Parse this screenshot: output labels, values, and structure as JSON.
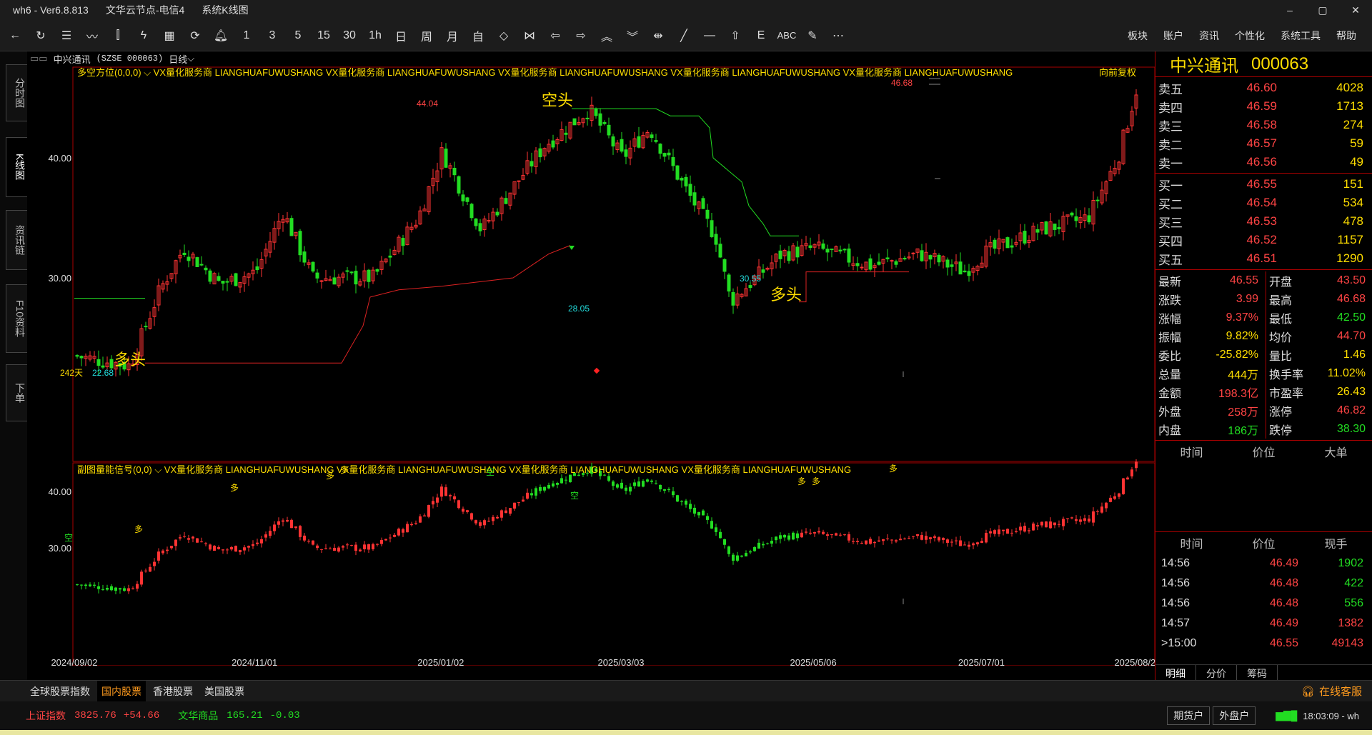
{
  "window": {
    "app": "wh6 - Ver6.8.813",
    "node": "文华云节点-电信4",
    "view": "系统K线图",
    "controls": [
      "–",
      "▢",
      "✕"
    ]
  },
  "toolbar": {
    "periods": [
      "1",
      "3",
      "5",
      "15",
      "30",
      "1h",
      "日",
      "周",
      "月",
      "自"
    ],
    "menu": [
      "板块",
      "账户",
      "资讯",
      "个性化",
      "系统工具",
      "帮助"
    ]
  },
  "left_tabs": [
    "分时图",
    "K线图",
    "资讯链",
    "F10资料",
    "下单"
  ],
  "chart_header": {
    "name": "中兴通讯",
    "code": "(SZSE 000063)",
    "period": "日线"
  },
  "main_panel": {
    "indicator": "多空方位(0,0,0)",
    "ads": [
      "VX量化服务商",
      "LIANGHUAFUWUSHANG",
      "VX量化服务商",
      "LIANGHUAFUWUSHANG",
      "VX量化服务商",
      "LIANGHUAFUWUSHANG",
      "VX量化服务商",
      "LIANGHUAFUWUSHANG",
      "VX量化服务商",
      "LIANGHUAFUWUSHANG"
    ],
    "adjust": "向前复权",
    "y_ticks": [
      "40.00",
      "30.00"
    ],
    "labels": {
      "high": "44.04",
      "last_high": "46.68",
      "low1": "22.68",
      "low2": "28.05",
      "low3": "30.55",
      "days": "242天",
      "bear": "空头",
      "bull1": "多头",
      "bull2": "多头"
    }
  },
  "sub_panel": {
    "indicator": "副图量能信号(0,0)",
    "ads": [
      "VX量化服务商",
      "LIANGHUAFUWUSHANG",
      "VX量化服务商",
      "LIANGHUAFUWUSHANG",
      "VX量化服务商",
      "LIANGHUAFUWUSHANG",
      "VX量化服务商",
      "LIANGHUAFUWUSHANG"
    ],
    "y_ticks": [
      "40.00",
      "30.00"
    ],
    "signals": [
      "空",
      "多",
      "多",
      "多",
      "多",
      "空",
      "空",
      "多",
      "多",
      "多"
    ]
  },
  "x_axis": [
    "2024/09/02",
    "2024/11/01",
    "2025/01/02",
    "2025/03/03",
    "2025/05/06",
    "2025/07/01",
    "2025/08/22"
  ],
  "chart_data": {
    "type": "candlestick",
    "x_range": [
      "2024/09/02",
      "2025/08/22"
    ],
    "ylim": [
      20,
      48
    ],
    "points": [
      {
        "date": "2024/09/02",
        "close": 23.5
      },
      {
        "date": "2024/09/20",
        "close": 22.68
      },
      {
        "date": "2024/09/30",
        "close": 29.0
      },
      {
        "date": "2024/10/08",
        "close": 32.5
      },
      {
        "date": "2024/10/20",
        "close": 29.5
      },
      {
        "date": "2024/11/01",
        "close": 30.5
      },
      {
        "date": "2024/11/10",
        "close": 35.5
      },
      {
        "date": "2024/11/20",
        "close": 30.0
      },
      {
        "date": "2024/12/10",
        "close": 30.0
      },
      {
        "date": "2024/12/25",
        "close": 35.0
      },
      {
        "date": "2025/01/02",
        "close": 40.5
      },
      {
        "date": "2025/01/15",
        "close": 34.0
      },
      {
        "date": "2025/02/05",
        "close": 41.0
      },
      {
        "date": "2025/02/20",
        "close": 44.04
      },
      {
        "date": "2025/03/03",
        "close": 40.0
      },
      {
        "date": "2025/03/12",
        "close": 42.5
      },
      {
        "date": "2025/03/25",
        "close": 37.0
      },
      {
        "date": "2025/04/03",
        "close": 33.5
      },
      {
        "date": "2025/04/08",
        "close": 28.05
      },
      {
        "date": "2025/04/25",
        "close": 32.0
      },
      {
        "date": "2025/05/06",
        "close": 32.5
      },
      {
        "date": "2025/05/25",
        "close": 31.0
      },
      {
        "date": "2025/06/10",
        "close": 32.0
      },
      {
        "date": "2025/06/25",
        "close": 30.55
      },
      {
        "date": "2025/07/01",
        "close": 32.0
      },
      {
        "date": "2025/07/20",
        "close": 34.0
      },
      {
        "date": "2025/08/05",
        "close": 35.0
      },
      {
        "date": "2025/08/15",
        "close": 40.0
      },
      {
        "date": "2025/08/22",
        "close": 46.55
      }
    ],
    "bear_line": 44.0,
    "bull_line": 33.5
  },
  "quote": {
    "name": "中兴通讯",
    "code": "000063",
    "asks": [
      {
        "label": "卖五",
        "price": "46.60",
        "vol": "4028"
      },
      {
        "label": "卖四",
        "price": "46.59",
        "vol": "1713"
      },
      {
        "label": "卖三",
        "price": "46.58",
        "vol": "274"
      },
      {
        "label": "卖二",
        "price": "46.57",
        "vol": "59"
      },
      {
        "label": "卖一",
        "price": "46.56",
        "vol": "49"
      }
    ],
    "bids": [
      {
        "label": "买一",
        "price": "46.55",
        "vol": "151"
      },
      {
        "label": "买二",
        "price": "46.54",
        "vol": "534"
      },
      {
        "label": "买三",
        "price": "46.53",
        "vol": "478"
      },
      {
        "label": "买四",
        "price": "46.52",
        "vol": "1157"
      },
      {
        "label": "买五",
        "price": "46.51",
        "vol": "1290"
      }
    ],
    "stats": [
      {
        "k": "最新",
        "v": "46.55",
        "c": "#ff4444"
      },
      {
        "k": "开盘",
        "v": "43.50",
        "c": "#ff4444"
      },
      {
        "k": "涨跌",
        "v": "3.99",
        "c": "#ff4444"
      },
      {
        "k": "最高",
        "v": "46.68",
        "c": "#ff4444"
      },
      {
        "k": "涨幅",
        "v": "9.37%",
        "c": "#ff4444"
      },
      {
        "k": "最低",
        "v": "42.50",
        "c": "#22dd22"
      },
      {
        "k": "振幅",
        "v": "9.82%",
        "c": "#ffde00"
      },
      {
        "k": "均价",
        "v": "44.70",
        "c": "#ff4444"
      },
      {
        "k": "委比",
        "v": "-25.82%",
        "c": "#ffde00"
      },
      {
        "k": "量比",
        "v": "1.46",
        "c": "#ffde00"
      },
      {
        "k": "总量",
        "v": "444万",
        "c": "#ffde00"
      },
      {
        "k": "换手率",
        "v": "11.02%",
        "c": "#ffde00"
      },
      {
        "k": "金额",
        "v": "198.3亿",
        "c": "#ff4444"
      },
      {
        "k": "市盈率",
        "v": "26.43",
        "c": "#ffde00"
      },
      {
        "k": "外盘",
        "v": "258万",
        "c": "#ff4444"
      },
      {
        "k": "涨停",
        "v": "46.82",
        "c": "#ff4444"
      },
      {
        "k": "内盘",
        "v": "186万",
        "c": "#22dd22"
      },
      {
        "k": "跌停",
        "v": "38.30",
        "c": "#22dd22"
      }
    ],
    "big_header": [
      "时间",
      "价位",
      "大单"
    ],
    "tick_header": [
      "时间",
      "价位",
      "现手"
    ],
    "ticks": [
      {
        "t": "14:56",
        "p": "46.49",
        "v": "1902",
        "c": "#22dd22"
      },
      {
        "t": "14:56",
        "p": "46.48",
        "v": "422",
        "c": "#22dd22"
      },
      {
        "t": "14:56",
        "p": "46.48",
        "v": "556",
        "c": "#22dd22"
      },
      {
        "t": "14:57",
        "p": "46.49",
        "v": "1382",
        "c": "#ff4444"
      },
      {
        "t": ">15:00",
        "p": "46.55",
        "v": "49143",
        "c": "#ff4444"
      }
    ],
    "tabs": [
      "明细",
      "分价",
      "筹码"
    ]
  },
  "market_tabs": [
    "全球股票指数",
    "国内股票",
    "香港股票",
    "美国股票"
  ],
  "service": "在线客服",
  "status": {
    "idx1_name": "上证指数",
    "idx1_val": "3825.76",
    "idx1_chg": "+54.66",
    "idx2_name": "文华商品",
    "idx2_val": "165.21",
    "idx2_chg": "-0.03",
    "btn1": "期货户",
    "btn2": "外盘户",
    "time": "18:03:09 - wh"
  }
}
